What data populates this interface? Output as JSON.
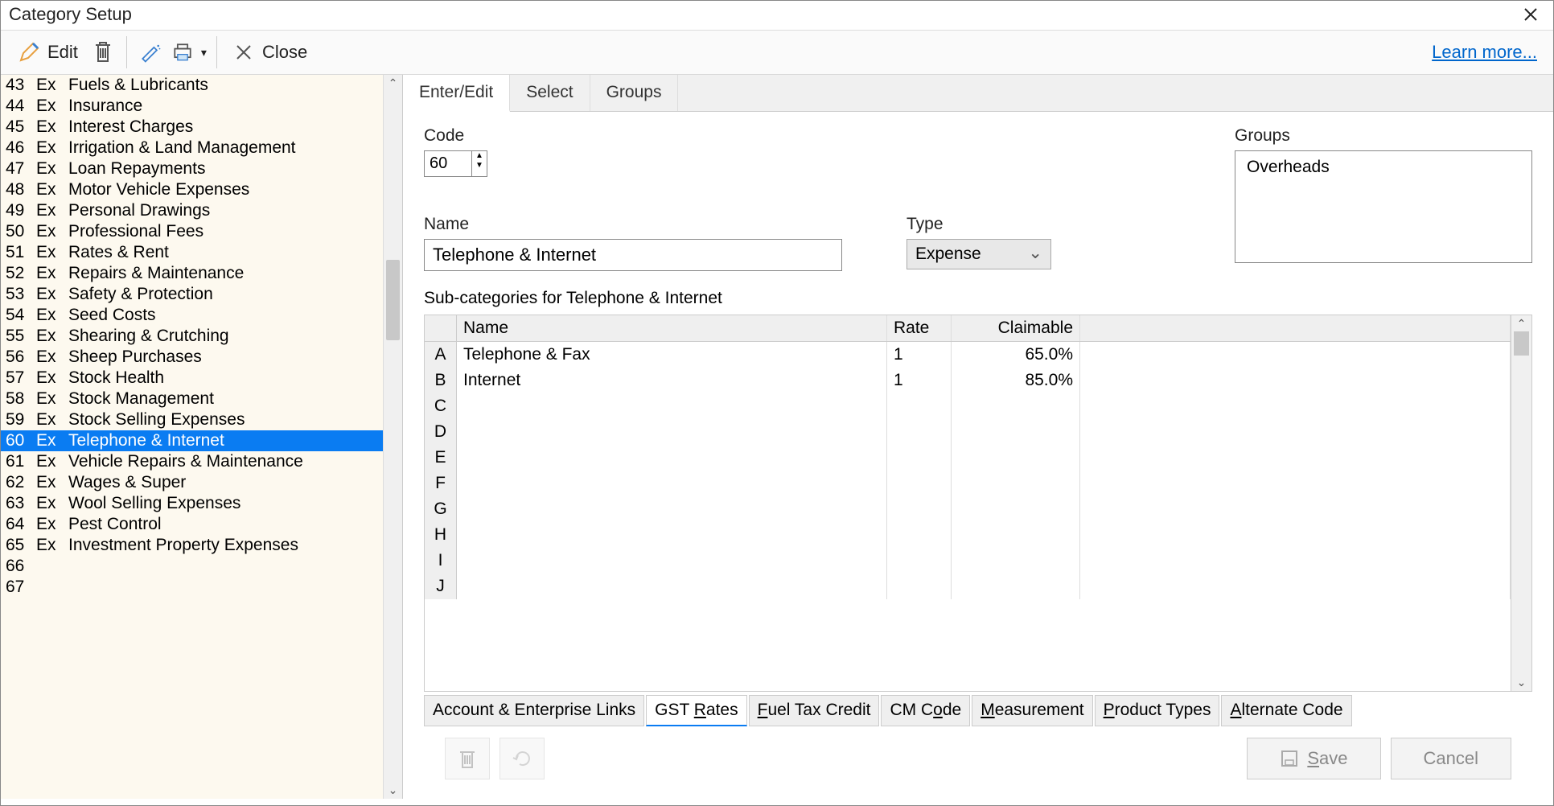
{
  "window": {
    "title": "Category Setup"
  },
  "toolbar": {
    "edit_label": "Edit",
    "close_label": "Close",
    "learn_more": "Learn more..."
  },
  "sidebar": {
    "items": [
      {
        "code": "43",
        "type": "Ex",
        "name": "Fuels & Lubricants"
      },
      {
        "code": "44",
        "type": "Ex",
        "name": "Insurance"
      },
      {
        "code": "45",
        "type": "Ex",
        "name": "Interest Charges"
      },
      {
        "code": "46",
        "type": "Ex",
        "name": "Irrigation & Land Management"
      },
      {
        "code": "47",
        "type": "Ex",
        "name": "Loan Repayments"
      },
      {
        "code": "48",
        "type": "Ex",
        "name": "Motor Vehicle Expenses"
      },
      {
        "code": "49",
        "type": "Ex",
        "name": "Personal Drawings"
      },
      {
        "code": "50",
        "type": "Ex",
        "name": "Professional Fees"
      },
      {
        "code": "51",
        "type": "Ex",
        "name": "Rates & Rent"
      },
      {
        "code": "52",
        "type": "Ex",
        "name": "Repairs & Maintenance"
      },
      {
        "code": "53",
        "type": "Ex",
        "name": "Safety & Protection"
      },
      {
        "code": "54",
        "type": "Ex",
        "name": "Seed Costs"
      },
      {
        "code": "55",
        "type": "Ex",
        "name": "Shearing & Crutching"
      },
      {
        "code": "56",
        "type": "Ex",
        "name": "Sheep Purchases"
      },
      {
        "code": "57",
        "type": "Ex",
        "name": "Stock Health"
      },
      {
        "code": "58",
        "type": "Ex",
        "name": "Stock Management"
      },
      {
        "code": "59",
        "type": "Ex",
        "name": "Stock Selling Expenses"
      },
      {
        "code": "60",
        "type": "Ex",
        "name": "Telephone & Internet",
        "selected": true
      },
      {
        "code": "61",
        "type": "Ex",
        "name": "Vehicle Repairs & Maintenance"
      },
      {
        "code": "62",
        "type": "Ex",
        "name": "Wages & Super"
      },
      {
        "code": "63",
        "type": "Ex",
        "name": "Wool Selling Expenses"
      },
      {
        "code": "64",
        "type": "Ex",
        "name": "Pest Control"
      },
      {
        "code": "65",
        "type": "Ex",
        "name": "Investment Property Expenses"
      },
      {
        "code": "66",
        "type": "",
        "name": ""
      },
      {
        "code": "67",
        "type": "",
        "name": ""
      }
    ]
  },
  "tabs": [
    {
      "label": "Enter/Edit",
      "active": true
    },
    {
      "label": "Select"
    },
    {
      "label": "Groups"
    }
  ],
  "form": {
    "code_label": "Code",
    "code_value": "60",
    "name_label": "Name",
    "name_value": "Telephone & Internet",
    "type_label": "Type",
    "type_value": "Expense",
    "groups_label": "Groups",
    "groups_value": "Overheads",
    "subcat_label": "Sub-categories for Telephone & Internet"
  },
  "grid": {
    "headers": {
      "name": "Name",
      "rate": "Rate",
      "claimable": "Claimable"
    },
    "rows": [
      {
        "letter": "A",
        "name": "Telephone & Fax",
        "rate": "1",
        "claimable": "65.0%"
      },
      {
        "letter": "B",
        "name": "Internet",
        "rate": "1",
        "claimable": "85.0%"
      },
      {
        "letter": "C"
      },
      {
        "letter": "D"
      },
      {
        "letter": "E"
      },
      {
        "letter": "F"
      },
      {
        "letter": "G"
      },
      {
        "letter": "H"
      },
      {
        "letter": "I"
      },
      {
        "letter": "J"
      }
    ]
  },
  "bottom_tabs": [
    {
      "label": "Account & Enterprise Links"
    },
    {
      "pre": "GST ",
      "ul": "R",
      "post": "ates",
      "active": true
    },
    {
      "ul": "F",
      "post": "uel Tax Credit"
    },
    {
      "pre": "CM C",
      "ul": "o",
      "post": "de"
    },
    {
      "ul": "M",
      "post": "easurement"
    },
    {
      "ul": "P",
      "post": "roduct Types"
    },
    {
      "ul": "A",
      "post": "lternate Code"
    }
  ],
  "footer": {
    "save": "Save",
    "cancel": "Cancel"
  }
}
